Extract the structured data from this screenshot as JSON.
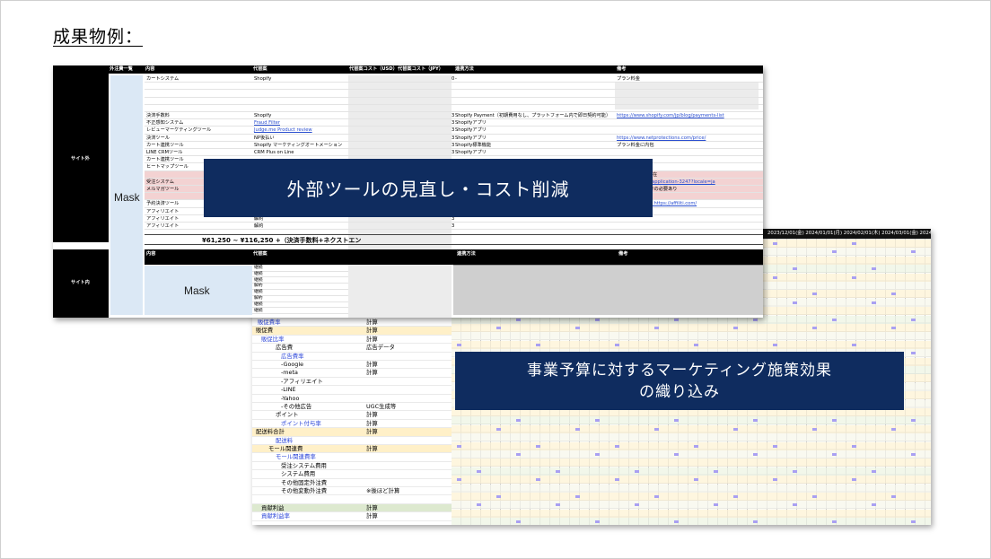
{
  "slide": {
    "heading": "成果物例："
  },
  "tools_sheet": {
    "side_label_1": "サイト外",
    "side_label_2": "サイト内",
    "column_header_a": "外注費一覧",
    "headers": [
      "内容",
      "代替案",
      "代替案コスト（USD）",
      "代替案コスト（JPY）",
      "連携方法",
      "備考"
    ],
    "headers_lower": [
      "内容",
      "代替案",
      "連携方法",
      "備考"
    ],
    "mask_label": "Mask",
    "rows": [
      {
        "content": "カートシステム",
        "alt": "Shopify",
        "cost": "0",
        "method": "-",
        "note": "プラン料金"
      },
      {
        "content": "",
        "alt": "",
        "cost": "",
        "method": "",
        "note": ""
      },
      {
        "content": "",
        "alt": "",
        "cost": "",
        "method": "",
        "note": ""
      },
      {
        "content": "",
        "alt": "",
        "cost": "",
        "method": "",
        "note": ""
      },
      {
        "content": "",
        "alt": "",
        "cost": "",
        "method": "",
        "note": ""
      },
      {
        "content": "決済手数料",
        "alt": "Shopify",
        "cost": "3",
        "method": "Shopify Payment（初期費用なし、プラットフォーム内で即日契約可能）",
        "note": "https://www.shopify.com/jp/blog/payments-list"
      },
      {
        "content": "不正感知システム",
        "alt": "Fraud Filter",
        "cost": "3",
        "method": "Shopifyアプリ",
        "note": ""
      },
      {
        "content": "レビューマーケティングツール",
        "alt": "Judge.me Product review",
        "cost": "3",
        "method": "Shopifyアプリ",
        "note": ""
      },
      {
        "content": "決済ツール",
        "alt": "NP後払い",
        "cost": "3",
        "method": "Shopifyアプリ",
        "note": "https://www.netprotections.com/price/"
      },
      {
        "content": "カート連携ツール",
        "alt": "Shopify マーケティングオートメーション",
        "cost": "3",
        "method": "Shopify標準機能",
        "note": "プラン料金に内包"
      },
      {
        "content": "LINE CRMツール",
        "alt": "CRM Plus on Line",
        "cost": "3",
        "method": "Shopifyアプリ",
        "note": ""
      },
      {
        "content": "カート連携ツール",
        "alt": "",
        "cost": "",
        "method": "",
        "note": ""
      },
      {
        "content": "ヒートマップツール",
        "alt": "",
        "cost": "",
        "method": "",
        "note": ""
      },
      {
        "content": "",
        "alt": "",
        "cost": "",
        "method": "",
        "note": "Shopifyアプリ有在"
      },
      {
        "content": "受注システム",
        "alt": "",
        "cost": "",
        "method": "",
        "note": "fy.com/shopify-application-3247?locale=ja"
      },
      {
        "content": "メルマガツール",
        "alt": "",
        "cost": "",
        "method": "",
        "note": "は別途問い合わせの必要あり"
      },
      {
        "content": "",
        "alt": "",
        "cost": "",
        "method": "",
        "note": "期限なく可能"
      },
      {
        "content": "予約決済ツール",
        "alt": "",
        "cost": "",
        "method": "",
        "note": "タートするなら　https://affiliti.com/"
      },
      {
        "content": "アフィリエイト",
        "alt": "",
        "cost": "",
        "method": "",
        "note": ""
      },
      {
        "content": "アフィリエイト",
        "alt": "解約",
        "cost": "3",
        "method": "",
        "note": ""
      },
      {
        "content": "アフィリエイト",
        "alt": "解約",
        "cost": "3",
        "method": "",
        "note": ""
      }
    ],
    "total_text": "¥61,250 ~ ¥116,250 +（決済手数料+ネクストエン",
    "lower_rows": [
      "継続",
      "継続",
      "継続",
      "解約",
      "継続",
      "解約",
      "継続",
      "継続"
    ]
  },
  "budget_sheet": {
    "date_headers": "2023/12/01(金) 2024/01/01(月) 2024/02/01(木) 2024/03/01(金) 2024/04/0",
    "rows": [
      {
        "label": "販促費率",
        "value": "計算",
        "indent": 6,
        "style": "blue"
      },
      {
        "label": "販促費",
        "value": "計算",
        "indent": 4,
        "style": "yellow"
      },
      {
        "label": "販促比率",
        "value": "計算",
        "indent": 10,
        "style": "blue"
      },
      {
        "label": "広告費",
        "value": "広告データ",
        "indent": 26,
        "style": "plain"
      },
      {
        "label": "広告費率",
        "value": "",
        "indent": 32,
        "style": "blue"
      },
      {
        "label": "-Google",
        "value": "計算",
        "indent": 32,
        "style": "plain"
      },
      {
        "label": "-meta",
        "value": "計算",
        "indent": 32,
        "style": "plain"
      },
      {
        "label": "-アフィリエイト",
        "value": "",
        "indent": 32,
        "style": "plain"
      },
      {
        "label": "-LINE",
        "value": "",
        "indent": 32,
        "style": "plain"
      },
      {
        "label": "-Yahoo",
        "value": "",
        "indent": 32,
        "style": "plain"
      },
      {
        "label": "-その他広告",
        "value": "UGC生成等",
        "indent": 32,
        "style": "plain"
      },
      {
        "label": "ポイント",
        "value": "計算",
        "indent": 26,
        "style": "plain"
      },
      {
        "label": "ポイント付与率",
        "value": "計算",
        "indent": 32,
        "style": "blue"
      },
      {
        "label": "配送料合計",
        "value": "計算",
        "indent": 4,
        "style": "yellow"
      },
      {
        "label": "配送料",
        "value": "",
        "indent": 26,
        "style": "blue"
      },
      {
        "label": "モール関連費",
        "value": "計算",
        "indent": 18,
        "style": "yellow"
      },
      {
        "label": "モール関連費率",
        "value": "",
        "indent": 26,
        "style": "blue"
      },
      {
        "label": "受注システム費用",
        "value": "",
        "indent": 32,
        "style": "plain"
      },
      {
        "label": "システム費用",
        "value": "",
        "indent": 32,
        "style": "plain"
      },
      {
        "label": "その他固定外注費",
        "value": "",
        "indent": 32,
        "style": "plain"
      },
      {
        "label": "その他変動外注費",
        "value": "※後ほど計算",
        "indent": 32,
        "style": "plain"
      },
      {
        "label": "",
        "value": "",
        "indent": 0,
        "style": "plain"
      },
      {
        "label": "貢献利益",
        "value": "計算",
        "indent": 10,
        "style": "green"
      },
      {
        "label": "貢献利益率",
        "value": "計算",
        "indent": 10,
        "style": "blue"
      }
    ]
  },
  "callouts": {
    "top": "外部ツールの見直し・コスト削減",
    "bottom_line1": "事業予算に対するマーケティング施策効果",
    "bottom_line2": "の織り込み"
  },
  "colors": {
    "callout_bg": "#0f2c5f",
    "mask_bg": "#dbe8f5",
    "highlight_pink": "#f3d2d2",
    "highlight_yellow": "#fff0c8",
    "highlight_green": "#dde9cf",
    "link_blue": "#2b4fd0"
  }
}
